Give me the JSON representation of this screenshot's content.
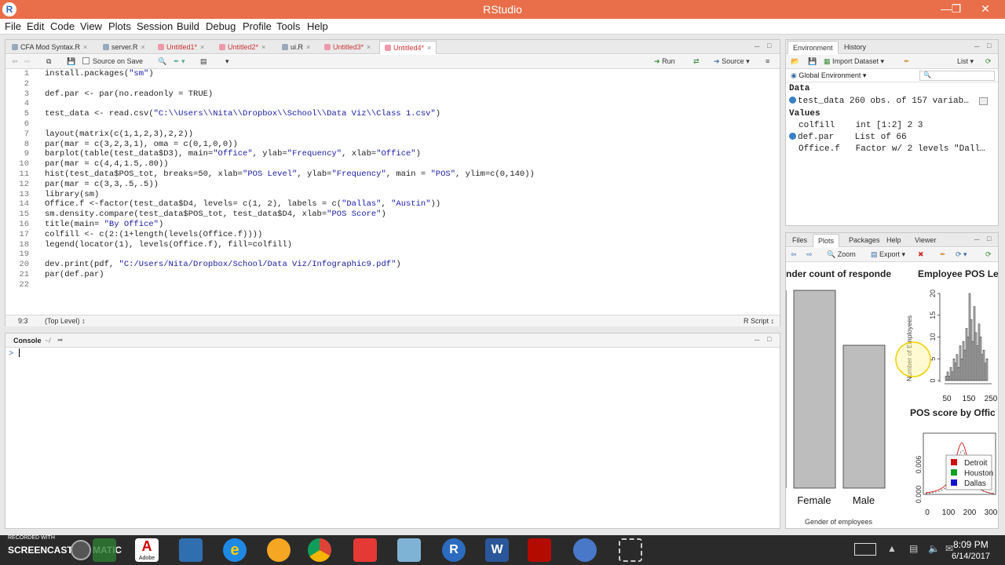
{
  "window": {
    "title": "RStudio",
    "logo": "R"
  },
  "menu": [
    "File",
    "Edit",
    "Code",
    "View",
    "Plots",
    "Session",
    "Build",
    "Debug",
    "Profile",
    "Tools",
    "Help"
  ],
  "editor": {
    "tabs": [
      {
        "label": "CFA Mod Syntax.R",
        "active": false
      },
      {
        "label": "server.R",
        "active": false
      },
      {
        "label": "Untitled1*",
        "active": false
      },
      {
        "label": "Untitled2*",
        "active": false
      },
      {
        "label": "ui.R",
        "active": false
      },
      {
        "label": "Untitled3*",
        "active": false
      },
      {
        "label": "Untitled4*",
        "active": true
      }
    ],
    "toolbar": {
      "source_on_save": "Source on Save",
      "run": "Run",
      "source": "Source"
    },
    "lines": [
      "install.packages(\"sm\")",
      "",
      "def.par <- par(no.readonly = TRUE)",
      "",
      "test_data <- read.csv(\"C:\\\\Users\\\\Nita\\\\Dropbox\\\\School\\\\Data Viz\\\\Class 1.csv\")",
      "",
      "layout(matrix(c(1,1,2,3),2,2))",
      "par(mar = c(3,2,3,1), oma = c(0,1,0,0))",
      "barplot(table(test_data$D3), main=\"Office\", ylab=\"Frequency\", xlab=\"Office\")",
      "par(mar = c(4,4,1.5,.80))",
      "hist(test_data$POS_tot, breaks=50, xlab=\"POS Level\", ylab=\"Frequency\", main = \"POS\", ylim=c(0,140))",
      "par(mar = c(3,3,.5,.5))",
      "library(sm)",
      "Office.f <-factor(test_data$D4, levels= c(1, 2), labels = c(\"Dallas\", \"Austin\"))",
      "sm.density.compare(test_data$POS_tot, test_data$D4, xlab=\"POS Score\")",
      "title(main= \"By Office\")",
      "colfill <- c(2:(1+length(levels(Office.f))))",
      "legend(locator(1), levels(Office.f), fill=colfill)",
      "",
      "dev.print(pdf, \"C:/Users/Nita/Dropbox/School/Data Viz/Infographic9.pdf\")",
      "par(def.par)",
      ""
    ],
    "status": {
      "position": "9:3",
      "scope": "(Top Level) ↕",
      "type": "R Script ↕"
    }
  },
  "console": {
    "title": "Console",
    "path": "~/",
    "prompt": ">"
  },
  "env": {
    "tabs": [
      "Environment",
      "History"
    ],
    "toolbar": {
      "import": "Import Dataset ▾",
      "list": "List ▾",
      "global": "Global Environment ▾"
    },
    "data_header": "Data",
    "values_header": "Values",
    "data_rows": [
      {
        "name": "test_data",
        "value": "260 obs. of 157 variab…"
      }
    ],
    "value_rows": [
      {
        "name": "colfill",
        "value": "int [1:2] 2 3"
      },
      {
        "name": "def.par",
        "value": "List of 66"
      },
      {
        "name": "Office.f",
        "value": "Factor w/ 2 levels \"Dall…"
      }
    ]
  },
  "plots": {
    "tabs": [
      "Files",
      "Plots",
      "Packages",
      "Help",
      "Viewer"
    ],
    "toolbar": {
      "zoom": "Zoom",
      "export": "Export ▾"
    },
    "bar": {
      "title": "nder count of responde",
      "categories": [
        "Female",
        "Male"
      ],
      "xlabel": "Gender of employees"
    },
    "hist": {
      "title": "Employee POS Le",
      "ylabel": "Number of Employees",
      "yticks": [
        "0",
        "5",
        "10",
        "15",
        "20"
      ],
      "xticks": [
        "50",
        "150",
        "250"
      ]
    },
    "density": {
      "title": "POS score by Offic",
      "yticks": [
        "0.000",
        "0.006"
      ],
      "xticks": [
        "0",
        "100",
        "200",
        "300"
      ],
      "legend": [
        {
          "name": "Detroit",
          "color": "#d01010"
        },
        {
          "name": "Houston",
          "color": "#10a020"
        },
        {
          "name": "Dallas",
          "color": "#1010d0"
        }
      ]
    }
  },
  "taskbar": {
    "watermark_top": "RECORDED WITH",
    "watermark": "SCREENCAST",
    "matic": "MATIC",
    "adobe": "Adobe",
    "time": "8:09 PM",
    "date": "6/14/2017"
  }
}
